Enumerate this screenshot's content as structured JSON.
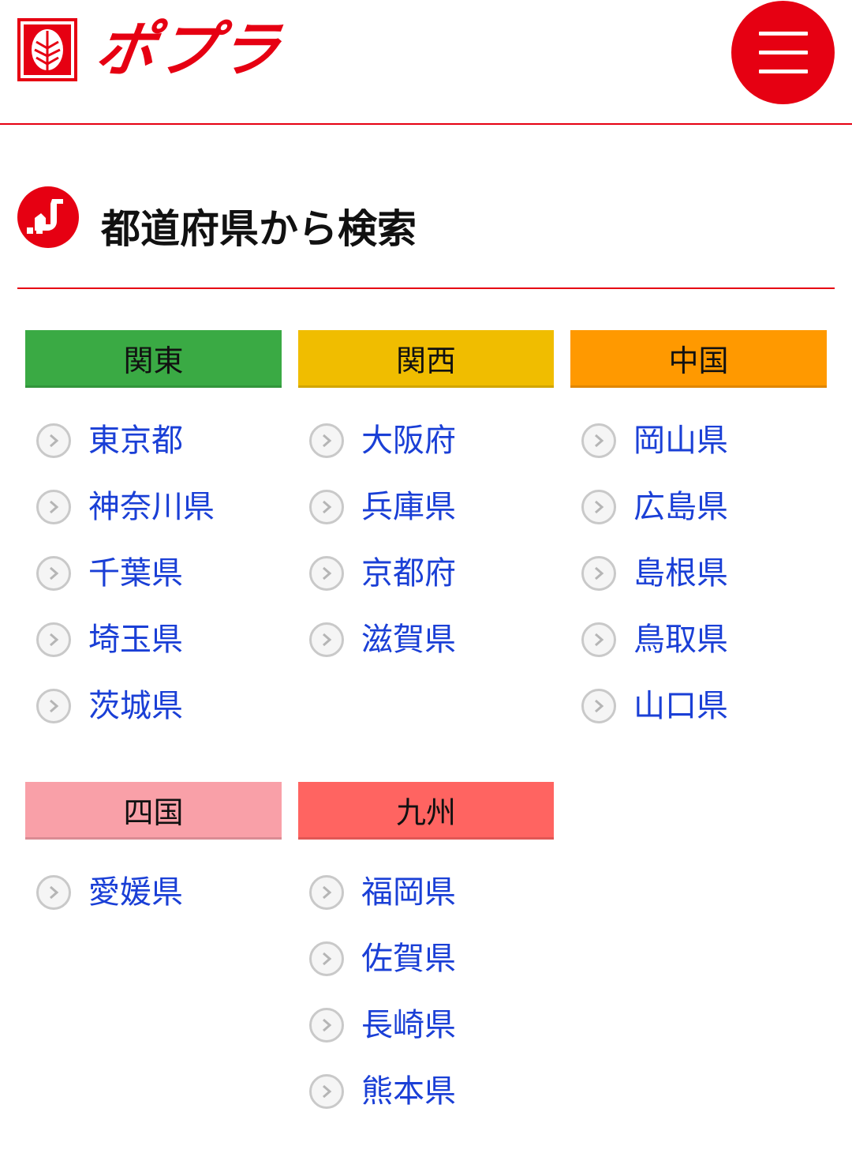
{
  "header": {
    "logo_text": "ポプラ",
    "menu_label": "メニュー"
  },
  "section": {
    "title": "都道府県から検索"
  },
  "regions": [
    {
      "name": "関東",
      "color": "#3aaa44",
      "prefectures": [
        "東京都",
        "神奈川県",
        "千葉県",
        "埼玉県",
        "茨城県"
      ]
    },
    {
      "name": "関西",
      "color": "#f0bd00",
      "prefectures": [
        "大阪府",
        "兵庫県",
        "京都府",
        "滋賀県"
      ]
    },
    {
      "name": "中国",
      "color": "#ff9900",
      "prefectures": [
        "岡山県",
        "広島県",
        "島根県",
        "鳥取県",
        "山口県"
      ]
    },
    {
      "name": "四国",
      "color": "#f9a0a8",
      "prefectures": [
        "愛媛県"
      ]
    },
    {
      "name": "九州",
      "color": "#ff6461",
      "prefectures": [
        "福岡県",
        "佐賀県",
        "長崎県",
        "熊本県"
      ]
    }
  ],
  "colors": {
    "brand_red": "#e60012",
    "link_blue": "#1a3fd6"
  },
  "icons": {
    "logo": "popla-leaf-logo-icon",
    "menu": "hamburger-menu-icon",
    "section": "map-pin-circle-icon",
    "list_bullet": "chevron-right-circle-icon"
  }
}
